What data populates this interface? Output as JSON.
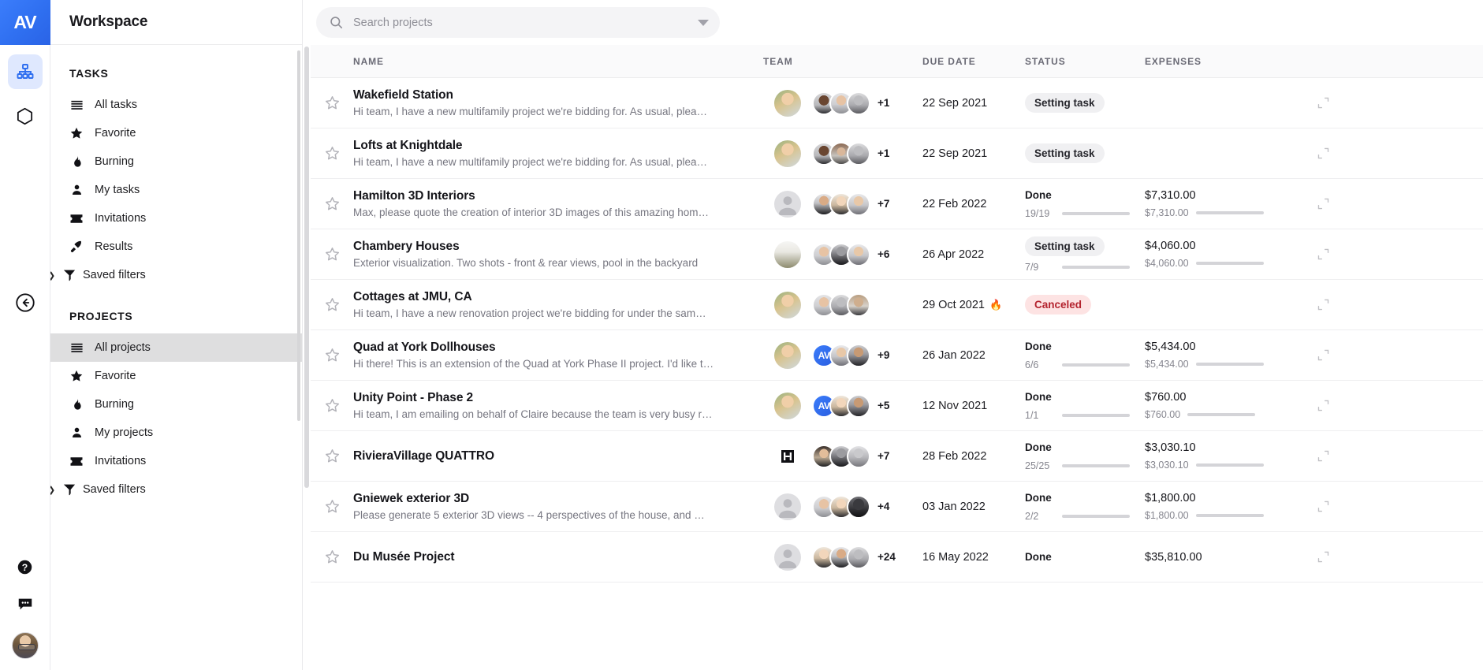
{
  "brand": {
    "logo_text": "AV",
    "accent": "#2f6ff0"
  },
  "rail": {
    "items": [
      {
        "name": "org-chart-icon",
        "label": "Workspace",
        "active": true
      },
      {
        "name": "cube-icon",
        "label": "Assets",
        "active": false
      }
    ],
    "collapse_label": "Collapse",
    "help_label": "Help",
    "chat_label": "Chat",
    "avatar_label": "My account"
  },
  "sidebar": {
    "workspace_title": "Workspace",
    "sections": [
      {
        "title": "TASKS",
        "items": [
          {
            "label": "All tasks",
            "icon": "list-icon",
            "selected": false,
            "caret": false
          },
          {
            "label": "Favorite",
            "icon": "star-icon",
            "selected": false,
            "caret": false
          },
          {
            "label": "Burning",
            "icon": "flame-icon",
            "selected": false,
            "caret": false
          },
          {
            "label": "My tasks",
            "icon": "person-icon",
            "selected": false,
            "caret": false
          },
          {
            "label": "Invitations",
            "icon": "ticket-icon",
            "selected": false,
            "caret": false
          },
          {
            "label": "Results",
            "icon": "rocket-icon",
            "selected": false,
            "caret": false
          },
          {
            "label": "Saved filters",
            "icon": "funnel-icon",
            "selected": false,
            "caret": true
          }
        ]
      },
      {
        "title": "PROJECTS",
        "items": [
          {
            "label": "All projects",
            "icon": "list-icon",
            "selected": true,
            "caret": false
          },
          {
            "label": "Favorite",
            "icon": "star-icon",
            "selected": false,
            "caret": false
          },
          {
            "label": "Burning",
            "icon": "flame-icon",
            "selected": false,
            "caret": false
          },
          {
            "label": "My projects",
            "icon": "person-icon",
            "selected": false,
            "caret": false
          },
          {
            "label": "Invitations",
            "icon": "ticket-icon",
            "selected": false,
            "caret": false
          },
          {
            "label": "Saved filters",
            "icon": "funnel-icon",
            "selected": false,
            "caret": true
          }
        ]
      }
    ]
  },
  "search": {
    "placeholder": "Search projects",
    "value": ""
  },
  "table": {
    "columns": [
      "NAME",
      "TEAM",
      "DUE DATE",
      "STATUS",
      "EXPENSES"
    ],
    "rows": [
      {
        "name": "Wakefield Station",
        "desc": "Hi team, I have a new multifamily project we're bidding for. As usual, plea…",
        "owner_style": "woman-blonde",
        "team": [
          "woman-glasses-dark",
          "man-young",
          "woman-bw"
        ],
        "team_more": "+1",
        "due": "22 Sep 2021",
        "burning": false,
        "status_type": "badge-grey",
        "status": "Setting task",
        "progress_label": "",
        "progress_pct": 0,
        "expense_top": "",
        "expense_sub": "",
        "expense_pct": 0
      },
      {
        "name": "Lofts at Knightdale",
        "desc": "Hi team, I have a new multifamily project we're bidding for. As usual, plea…",
        "owner_style": "woman-blonde",
        "team": [
          "woman-glasses-dark",
          "woman-bangs",
          "woman-bw"
        ],
        "team_more": "+1",
        "due": "22 Sep 2021",
        "burning": false,
        "status_type": "badge-grey",
        "status": "Setting task",
        "progress_label": "",
        "progress_pct": 0,
        "expense_top": "",
        "expense_sub": "",
        "expense_pct": 0
      },
      {
        "name": "Hamilton 3D Interiors",
        "desc": "Max, please quote the creation of interior 3D images of this amazing hom…",
        "owner_style": "placeholder",
        "team": [
          "man-beard",
          "woman-light",
          "man-short"
        ],
        "team_more": "+7",
        "due": "22 Feb 2022",
        "burning": false,
        "status_type": "done",
        "status": "Done",
        "progress_label": "19/19",
        "progress_pct": 100,
        "expense_top": "$7,310.00",
        "expense_sub": "$7,310.00",
        "expense_pct": 100
      },
      {
        "name": "Chambery Houses",
        "desc": "Exterior visualization. Two shots - front & rear views, pool in the backyard",
        "owner_style": "statue",
        "team": [
          "man-young",
          "man-beard-bw",
          "man-short"
        ],
        "team_more": "+6",
        "due": "26 Apr 2022",
        "burning": false,
        "status_type": "badge-grey",
        "status": "Setting task",
        "progress_label": "7/9",
        "progress_pct": 78,
        "expense_top": "$4,060.00",
        "expense_sub": "$4,060.00",
        "expense_pct": 100
      },
      {
        "name": "Cottages at JMU, CA",
        "desc": "Hi team, I have a new renovation project we're bidding for under the sam…",
        "owner_style": "woman-blonde",
        "team": [
          "man-young",
          "woman-bw",
          "woman-glasses"
        ],
        "team_more": "",
        "due": "29 Oct 2021",
        "burning": true,
        "status_type": "badge-red",
        "status": "Canceled",
        "progress_label": "",
        "progress_pct": 0,
        "expense_top": "",
        "expense_sub": "",
        "expense_pct": 0
      },
      {
        "name": "Quad at York Dollhouses",
        "desc": "Hi there! This is an extension of the Quad at York Phase II project. I'd like t…",
        "owner_style": "woman-blonde",
        "team": [
          "brand-av",
          "man-short",
          "man-dark"
        ],
        "team_more": "+9",
        "due": "26 Jan 2022",
        "burning": false,
        "status_type": "done",
        "status": "Done",
        "progress_label": "6/6",
        "progress_pct": 100,
        "expense_top": "$5,434.00",
        "expense_sub": "$5,434.00",
        "expense_pct": 100
      },
      {
        "name": "Unity Point - Phase 2",
        "desc": "Hi team, I am emailing on behalf of Claire because the team is very busy r…",
        "owner_style": "woman-blonde",
        "team": [
          "brand-av",
          "woman-light",
          "man-dark"
        ],
        "team_more": "+5",
        "due": "12 Nov 2021",
        "burning": false,
        "status_type": "done",
        "status": "Done",
        "progress_label": "1/1",
        "progress_pct": 100,
        "expense_top": "$760.00",
        "expense_sub": "$760.00",
        "expense_pct": 100
      },
      {
        "name": "RivieraVillage QUATTRO",
        "desc": "",
        "owner_style": "mono-logo",
        "team": [
          "woman-dark",
          "man-beard-bw",
          "man-grey"
        ],
        "team_more": "+7",
        "due": "28 Feb 2022",
        "burning": false,
        "status_type": "done",
        "status": "Done",
        "progress_label": "25/25",
        "progress_pct": 100,
        "expense_top": "$3,030.10",
        "expense_sub": "$3,030.10",
        "expense_pct": 100
      },
      {
        "name": "Gniewek exterior 3D",
        "desc": "Please generate 5 exterior 3D views -- 4 perspectives of the house, and …",
        "owner_style": "placeholder",
        "team": [
          "man-young",
          "woman-light",
          "man-dark-circle"
        ],
        "team_more": "+4",
        "due": "03 Jan 2022",
        "burning": false,
        "status_type": "done",
        "status": "Done",
        "progress_label": "2/2",
        "progress_pct": 100,
        "expense_top": "$1,800.00",
        "expense_sub": "$1,800.00",
        "expense_pct": 100
      },
      {
        "name": "Du Musée Project",
        "desc": "",
        "owner_style": "placeholder",
        "team": [
          "woman-light",
          "man-beard",
          "woman-bw"
        ],
        "team_more": "+24",
        "due": "16 May 2022",
        "burning": false,
        "status_type": "done",
        "status": "Done",
        "progress_label": "",
        "progress_pct": 0,
        "expense_top": "$35,810.00",
        "expense_sub": "",
        "expense_pct": 0
      }
    ]
  },
  "colors": {
    "progress_green": "#17b26a",
    "badge_grey_bg": "#f0f0f2",
    "badge_red_bg": "#fde3e3",
    "badge_red_fg": "#b4232e"
  }
}
